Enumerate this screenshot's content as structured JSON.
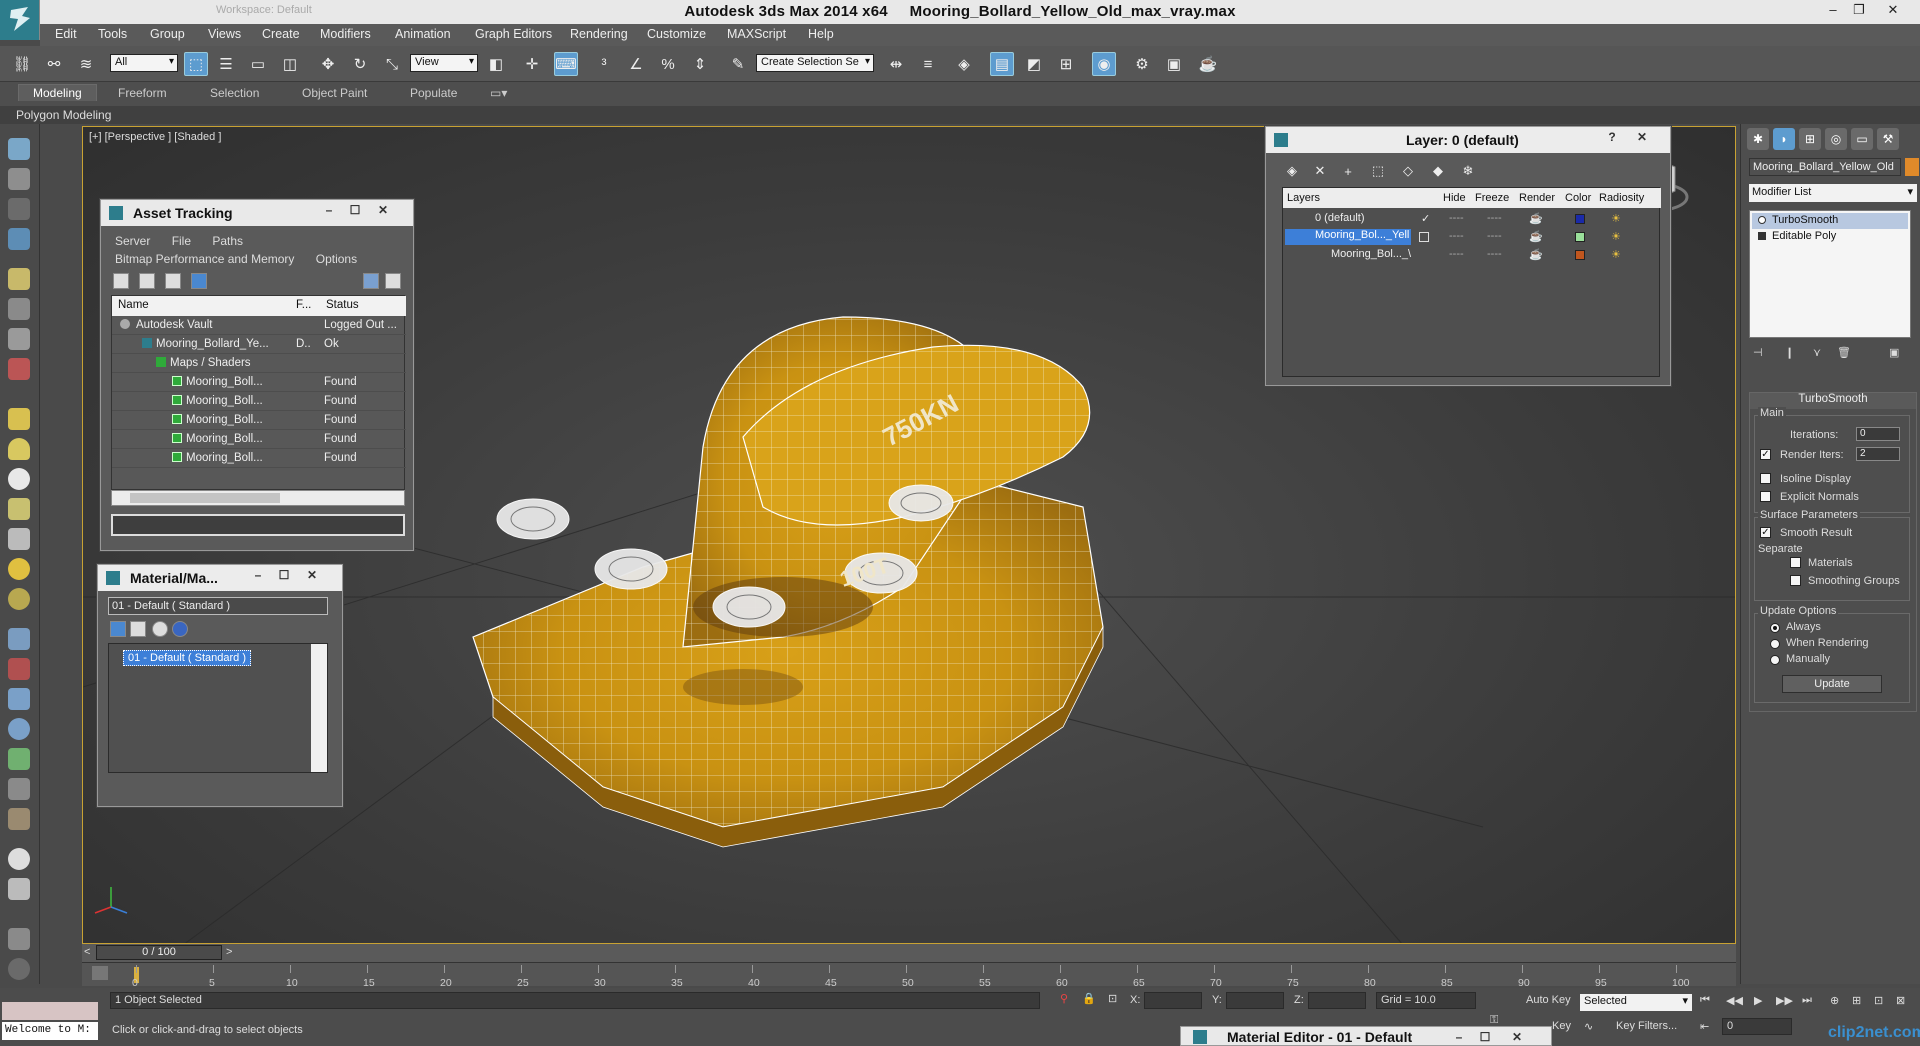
{
  "app": {
    "title": "Autodesk 3ds Max  2014 x64",
    "filename": "Mooring_Bollard_Yellow_Old_max_vray.max",
    "search_placeholder": "Workspace: Default"
  },
  "menu": [
    "Edit",
    "Tools",
    "Group",
    "Views",
    "Create",
    "Modifiers",
    "Animation",
    "Graph Editors",
    "Rendering",
    "Customize",
    "MAXScript",
    "Help"
  ],
  "toolbar": {
    "filter": "All",
    "ref_coord": "View",
    "selection_set": "Create Selection Se"
  },
  "ribbon": {
    "tabs": [
      "Modeling",
      "Freeform",
      "Selection",
      "Object Paint",
      "Populate"
    ],
    "active_tab": "Modeling",
    "sub_label": "Polygon Modeling"
  },
  "viewport": {
    "label": "[+] [Perspective ] [Shaded ]",
    "model_text_1": "750KN",
    "model_text_2": "100T"
  },
  "asset_tracking": {
    "title": "Asset Tracking",
    "menu_row1": [
      "Server",
      "File",
      "Paths"
    ],
    "menu_row2": [
      "Bitmap Performance and Memory",
      "Options"
    ],
    "columns": [
      "Name",
      "F...",
      "Status"
    ],
    "rows": [
      {
        "name": "Autodesk Vault",
        "f": "",
        "status": "Logged Out ..."
      },
      {
        "name": "Mooring_Bollard_Ye...",
        "f": "D..",
        "status": "Ok"
      },
      {
        "name": "Maps / Shaders",
        "f": "",
        "status": ""
      },
      {
        "name": "Mooring_Boll...",
        "f": "",
        "status": "Found"
      },
      {
        "name": "Mooring_Boll...",
        "f": "",
        "status": "Found"
      },
      {
        "name": "Mooring_Boll...",
        "f": "",
        "status": "Found"
      },
      {
        "name": "Mooring_Boll...",
        "f": "",
        "status": "Found"
      },
      {
        "name": "Mooring_Boll...",
        "f": "",
        "status": "Found"
      }
    ]
  },
  "material_browser": {
    "title": "Material/Ma...",
    "field": "01 - Default  ( Standard )",
    "selected": "01 - Default  ( Standard )"
  },
  "layer_dialog": {
    "title": "Layer: 0 (default)",
    "help": "?",
    "columns": [
      "Layers",
      "Hide",
      "Freeze",
      "Render",
      "Color",
      "Radiosity"
    ],
    "rows": [
      {
        "name": "0 (default)",
        "color": "#1a2aa8"
      },
      {
        "name": "Mooring_Bol..._Yell",
        "color": "#9adf9a"
      },
      {
        "name": "Mooring_Bol..._\\",
        "color": "#c0561e"
      }
    ],
    "line_marker": "----"
  },
  "command_panel": {
    "object_name": "Mooring_Bollard_Yellow_Old",
    "modifier_list": "Modifier List",
    "stack": [
      "TurboSmooth",
      "Editable Poly"
    ],
    "rollout_title": "TurboSmooth",
    "main_label": "Main",
    "iterations_label": "Iterations:",
    "iterations": "0",
    "render_iters_label": "Render Iters:",
    "render_iters": "2",
    "isoline": "Isoline Display",
    "explicit_normals": "Explicit Normals",
    "surface_params": "Surface Parameters",
    "smooth_result": "Smooth Result",
    "separate": "Separate",
    "materials": "Materials",
    "smoothing_groups": "Smoothing Groups",
    "update_options": "Update Options",
    "always": "Always",
    "when_rendering": "When Rendering",
    "manually": "Manually",
    "update_btn": "Update"
  },
  "timeline": {
    "position": "0 / 100",
    "ticks": [
      "0",
      "5",
      "10",
      "15",
      "20",
      "25",
      "30",
      "35",
      "40",
      "45",
      "50",
      "55",
      "60",
      "65",
      "70",
      "75",
      "80",
      "85",
      "90",
      "95",
      "100"
    ]
  },
  "status": {
    "maxscript_prompt": "Welcome to M:",
    "selected_count": "1 Object Selected",
    "hint": "Click or click-and-drag to select objects",
    "x_label": "X:",
    "y_label": "Y:",
    "z_label": "Z:",
    "grid": "Grid = 10.0",
    "auto_key": "Auto Key",
    "set_key": "Key",
    "selected_dd": "Selected",
    "key_filters": "Key Filters...",
    "frame": "0"
  },
  "material_editor_tab": "Material Editor - 01 - Default",
  "watermark": "clip2net.com"
}
